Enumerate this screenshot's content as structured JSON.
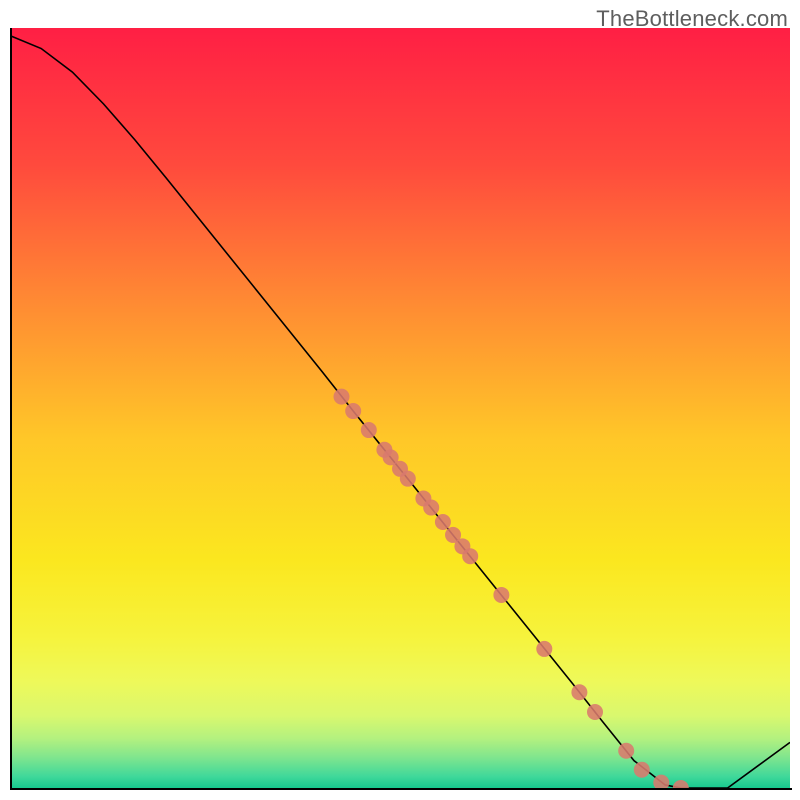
{
  "watermark": "TheBottleneck.com",
  "chart_data": {
    "type": "line",
    "title": "",
    "xlabel": "",
    "ylabel": "",
    "xlim": [
      0,
      100
    ],
    "ylim": [
      0,
      100
    ],
    "grid": false,
    "series": [
      {
        "name": "bottleneck-curve",
        "x": [
          0,
          4,
          8,
          12,
          16,
          20,
          24,
          28,
          32,
          36,
          40,
          44,
          48,
          52,
          56,
          60,
          64,
          68,
          72,
          76,
          80,
          84,
          86,
          88,
          92,
          96,
          100
        ],
        "y": [
          99,
          97.3,
          94.2,
          90.0,
          85.3,
          80.3,
          75.2,
          70.1,
          65.0,
          59.9,
          54.8,
          49.6,
          44.5,
          39.4,
          34.3,
          29.2,
          24.1,
          19.0,
          13.9,
          8.7,
          3.6,
          0.4,
          0.0,
          0.0,
          0.0,
          3.0,
          6.0
        ]
      }
    ],
    "scatter": {
      "name": "sample-points",
      "color": "#d97a6d",
      "points": [
        {
          "x": 42.5,
          "y": 51.5
        },
        {
          "x": 44.0,
          "y": 49.6
        },
        {
          "x": 46.0,
          "y": 47.1
        },
        {
          "x": 48.0,
          "y": 44.5
        },
        {
          "x": 48.8,
          "y": 43.5
        },
        {
          "x": 50.0,
          "y": 42.0
        },
        {
          "x": 51.0,
          "y": 40.7
        },
        {
          "x": 53.0,
          "y": 38.1
        },
        {
          "x": 54.0,
          "y": 36.9
        },
        {
          "x": 55.5,
          "y": 35.0
        },
        {
          "x": 56.8,
          "y": 33.3
        },
        {
          "x": 58.0,
          "y": 31.8
        },
        {
          "x": 59.0,
          "y": 30.5
        },
        {
          "x": 63.0,
          "y": 25.4
        },
        {
          "x": 68.5,
          "y": 18.3
        },
        {
          "x": 73.0,
          "y": 12.6
        },
        {
          "x": 75.0,
          "y": 10.0
        },
        {
          "x": 79.0,
          "y": 4.9
        },
        {
          "x": 81.0,
          "y": 2.4
        },
        {
          "x": 83.5,
          "y": 0.7
        },
        {
          "x": 86.0,
          "y": 0.0
        }
      ]
    },
    "background_gradient": {
      "stops": [
        {
          "pos": 0.0,
          "color": "#ff1f44"
        },
        {
          "pos": 0.18,
          "color": "#ff4a3d"
        },
        {
          "pos": 0.36,
          "color": "#ff8a33"
        },
        {
          "pos": 0.54,
          "color": "#ffc728"
        },
        {
          "pos": 0.7,
          "color": "#fbe71f"
        },
        {
          "pos": 0.8,
          "color": "#f6f33c"
        },
        {
          "pos": 0.86,
          "color": "#eef95a"
        },
        {
          "pos": 0.905,
          "color": "#d9f86e"
        },
        {
          "pos": 0.935,
          "color": "#b3f17f"
        },
        {
          "pos": 0.96,
          "color": "#7fe58e"
        },
        {
          "pos": 0.985,
          "color": "#3fd89a"
        },
        {
          "pos": 1.0,
          "color": "#17c98f"
        }
      ]
    }
  }
}
